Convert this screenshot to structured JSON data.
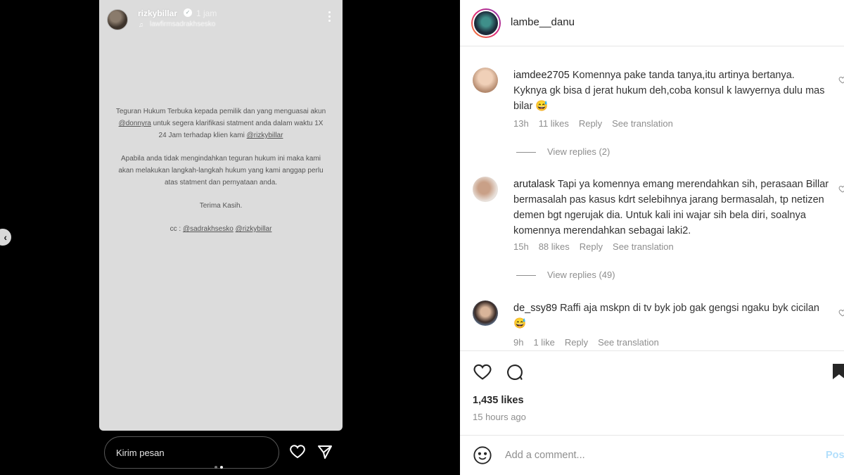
{
  "story": {
    "username": "rizkybillar",
    "time": "1 jam",
    "audio": "lawfirmsadrakhsesko",
    "paragraphs": {
      "p1_a": "Teguran Hukum Terbuka kepada pemilik dan yang menguasai akun ",
      "p1_mention1": "@donnyra",
      "p1_b": " untuk segera klarifikasi statment anda dalam waktu 1X 24 Jam terhadap klien kami ",
      "p1_mention2": "@rizkybillar",
      "p2": "Apabila anda tidak mengindahkan teguran hukum ini maka kami akan melakukan langkah-langkah hukum yang kami anggap perlu atas statment dan pernyataan anda.",
      "p3": "Terima Kasih.",
      "cc_prefix": "cc : ",
      "cc_mention1": "@sadrakhsesko",
      "cc_mention2": "@rizkybillar"
    },
    "message_placeholder": "Kirim pesan",
    "dots": 2,
    "active_dot": 1
  },
  "post": {
    "username": "lambe__danu",
    "comments": [
      {
        "user": "iamdee2705",
        "text": "Komennya pake tanda tanya,itu artinya bertanya. Kyknya gk bisa d jerat hukum deh,coba konsul k lawyernya dulu mas bilar 😅",
        "time": "13h",
        "likes": "11 likes",
        "reply": "Reply",
        "translation": "See translation",
        "view_replies": "View replies (2)"
      },
      {
        "user": "arutalask",
        "text": "Tapi ya komennya emang merendahkan sih, perasaan Billar bermasalah pas kasus kdrt selebihnya jarang bermasalah, tp netizen demen bgt ngerujak dia. Untuk kali ini wajar sih bela diri, soalnya komennya merendahkan sebagai laki2.",
        "time": "15h",
        "likes": "88 likes",
        "reply": "Reply",
        "translation": "See translation",
        "view_replies": "View replies (49)"
      },
      {
        "user": "de_ssy89",
        "text": "Raffi aja mskpn di tv byk job gak gengsi ngaku byk cicilan 😅",
        "time": "9h",
        "likes": "1 like",
        "reply": "Reply",
        "translation": "See translation"
      }
    ],
    "likes_count": "1,435 likes",
    "posted_ago": "15 hours ago",
    "add_comment_placeholder": "Add a comment...",
    "post_button": "Post"
  },
  "colors": {
    "story_bg": "#dcdcdc",
    "meta_gray": "#8e8e8e",
    "post_button": "#b2dffc"
  }
}
